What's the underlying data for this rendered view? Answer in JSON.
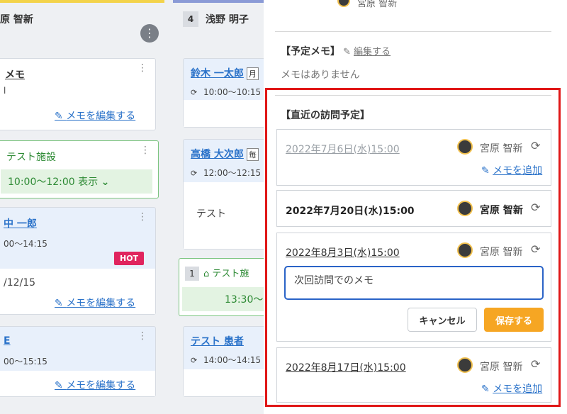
{
  "board": {
    "col1": {
      "header": "原 智新",
      "cards": [
        {
          "title": "メモ",
          "line2": "l",
          "edit": "メモを編集する"
        },
        {
          "facility": "テスト施設",
          "time": "10:00〜12:00 表示"
        },
        {
          "title": "中 一郎",
          "time": "00〜14:15",
          "badge": "HOT",
          "date": "/12/15",
          "edit": "メモを編集する"
        },
        {
          "title": "E",
          "time": "00〜15:15",
          "edit": "メモを編集する"
        }
      ]
    },
    "col2": {
      "count": "4",
      "header": "浅野 明子",
      "cards": [
        {
          "name": "鈴木 一太郎",
          "tag": "月",
          "time": "10:00〜10:15"
        },
        {
          "name": "高橋 大次郎",
          "tag": "毎",
          "time": "12:00〜12:15",
          "memo": "テスト"
        },
        {
          "count": "1",
          "facility": "テスト施",
          "time": "13:30〜"
        },
        {
          "name": "テスト 患者",
          "time": "14:00〜14:15"
        }
      ]
    }
  },
  "panel": {
    "top_name": "宮原 智新",
    "memo_section": {
      "title": "【予定メモ】",
      "edit_label": "編集する",
      "empty_text": "メモはありません"
    },
    "visits_section": {
      "title": "【直近の訪問予定】",
      "visits": [
        {
          "date": "2022年7月6日(水)15:00",
          "staff": "宮原 智新",
          "add_memo": "メモを追加"
        },
        {
          "date": "2022年7月20日(水)15:00",
          "staff": "宮原 智新"
        },
        {
          "date": "2022年8月3日(水)15:00",
          "staff": "宮原 智新",
          "memo_value": "次回訪問でのメモ",
          "cancel": "キャンセル",
          "save": "保存する"
        },
        {
          "date": "2022年8月17日(水)15:00",
          "staff": "宮原 智新",
          "add_memo": "メモを追加"
        }
      ]
    }
  },
  "colors": {
    "accent_red": "#e01717",
    "save": "#f6a623",
    "link": "#2a72c9",
    "hot": "#e0245e"
  }
}
